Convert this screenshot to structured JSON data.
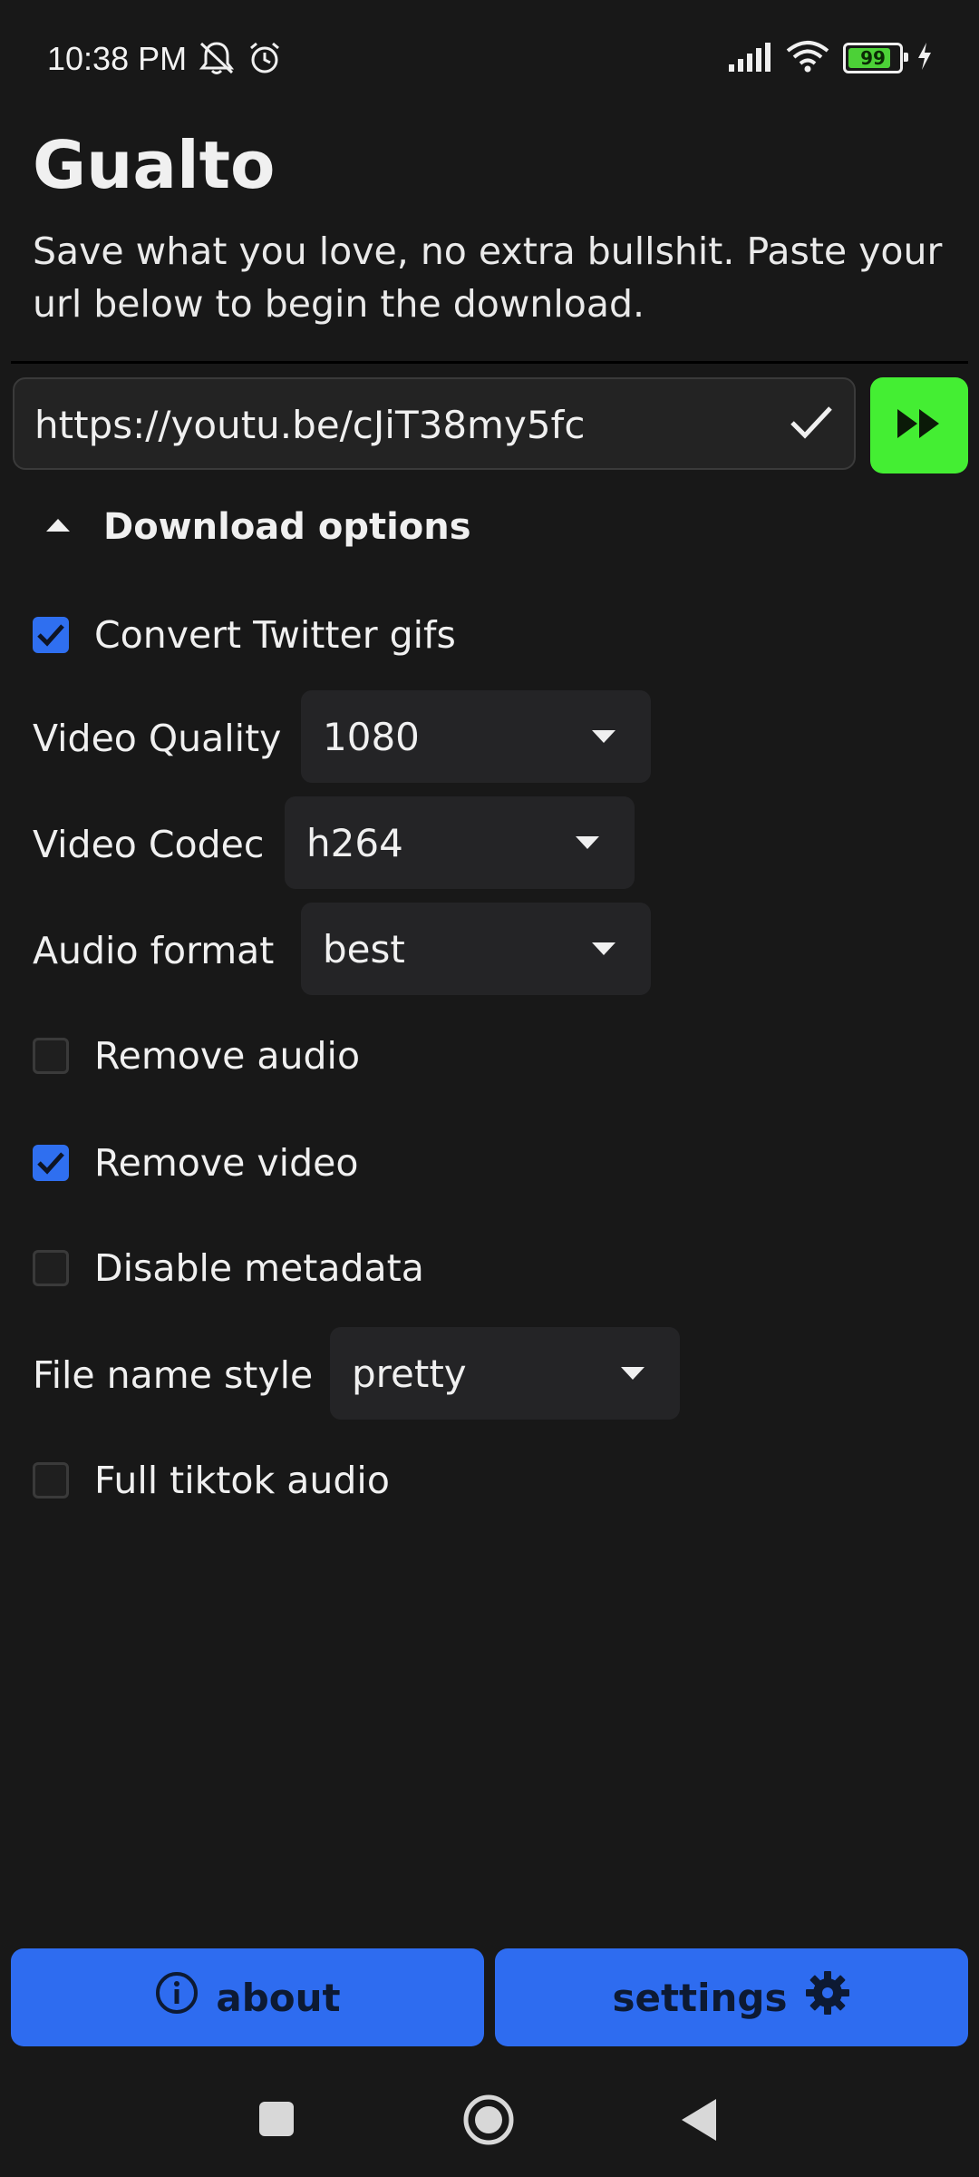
{
  "status_bar": {
    "time": "10:38 PM",
    "battery": "99",
    "icons": [
      "bell-off-icon",
      "alarm-icon",
      "signal-icon",
      "wifi-icon",
      "battery-icon",
      "charging-icon"
    ]
  },
  "app": {
    "title": "Gualto",
    "subtitle": "Save what you love, no extra bullshit. Paste your url below to begin the download."
  },
  "url_input": {
    "value": "https://youtu.be/cJiT38my5fc"
  },
  "download_options": {
    "title": "Download options",
    "convert_twitter_gifs": {
      "label": "Convert Twitter gifs",
      "checked": true
    },
    "video_quality": {
      "label": "Video Quality",
      "value": "1080"
    },
    "video_codec": {
      "label": "Video Codec",
      "value": "h264"
    },
    "audio_format": {
      "label": "Audio format",
      "value": "best"
    },
    "remove_audio": {
      "label": "Remove audio",
      "checked": false
    },
    "remove_video": {
      "label": "Remove video",
      "checked": true
    },
    "disable_metadata": {
      "label": "Disable metadata",
      "checked": false
    },
    "file_name_style": {
      "label": "File name style",
      "value": "pretty"
    },
    "full_tiktok_audio": {
      "label": "Full tiktok audio",
      "checked": false
    }
  },
  "bottom_buttons": {
    "about": "about",
    "settings": "settings"
  },
  "colors": {
    "background": "#181818",
    "accent_blue": "#2e6cf0",
    "go_green": "#44ee33",
    "checkbox_blue": "#2f6ff0"
  }
}
